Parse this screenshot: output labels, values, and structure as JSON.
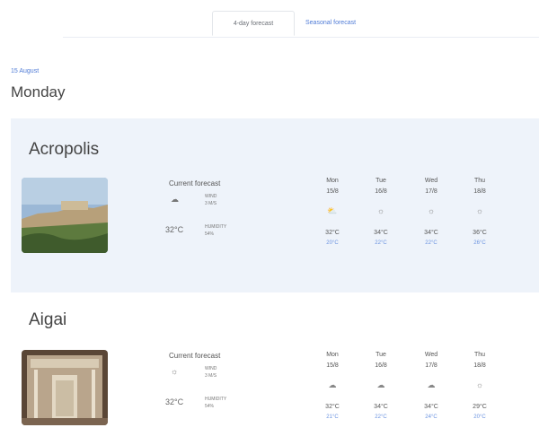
{
  "tabs": [
    {
      "label": "4-day forecast",
      "active": true
    },
    {
      "label": "Seasonal forecast",
      "active": false
    }
  ],
  "header": {
    "date": "15 August",
    "day": "Monday"
  },
  "sites": [
    {
      "name": "Acropolis",
      "current": {
        "heading": "Current forecast",
        "wind_line1": "WIND",
        "wind_line2": "3 M/S",
        "temp": "32°C",
        "humidity_line1": "HUMIDITY",
        "humidity_line2": "54%"
      },
      "days": [
        {
          "name": "Mon",
          "date": "15/8",
          "icon": "sun-cloud-icon",
          "glyph": "⛅",
          "hi": "32°C",
          "lo": "20°C"
        },
        {
          "name": "Tue",
          "date": "16/8",
          "icon": "sun-icon",
          "glyph": "☼",
          "hi": "34°C",
          "lo": "22°C"
        },
        {
          "name": "Wed",
          "date": "17/8",
          "icon": "sun-icon",
          "glyph": "☼",
          "hi": "34°C",
          "lo": "22°C"
        },
        {
          "name": "Thu",
          "date": "18/8",
          "icon": "sun-icon",
          "glyph": "☼",
          "hi": "36°C",
          "lo": "26°C"
        }
      ]
    },
    {
      "name": "Aigai",
      "current": {
        "heading": "Current forecast",
        "wind_line1": "WIND",
        "wind_line2": "3 M/S",
        "temp": "32°C",
        "humidity_line1": "HUMIDITY",
        "humidity_line2": "54%"
      },
      "days": [
        {
          "name": "Mon",
          "date": "15/8",
          "icon": "cloud-icon",
          "glyph": "☁",
          "hi": "32°C",
          "lo": "21°C"
        },
        {
          "name": "Tue",
          "date": "16/8",
          "icon": "cloud-icon",
          "glyph": "☁",
          "hi": "34°C",
          "lo": "22°C"
        },
        {
          "name": "Wed",
          "date": "17/8",
          "icon": "cloud-icon",
          "glyph": "☁",
          "hi": "34°C",
          "lo": "24°C"
        },
        {
          "name": "Thu",
          "date": "18/8",
          "icon": "sun-icon",
          "glyph": "☼",
          "hi": "29°C",
          "lo": "20°C"
        }
      ]
    }
  ]
}
